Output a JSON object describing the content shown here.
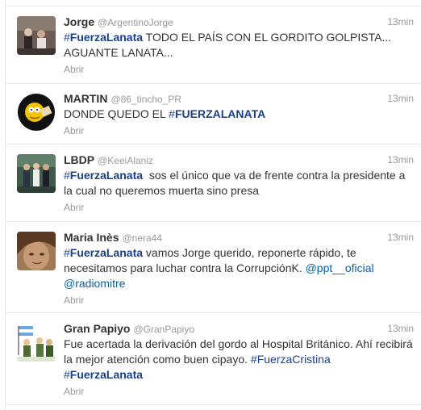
{
  "tweets": [
    {
      "name": "Jorge",
      "handle": "@ArgentinoJorge",
      "time": "13min",
      "text": {
        "hashtag_hash": "#",
        "hashtag_word": "FuerzaLanata",
        "body": " TODO EL PAÍS CON EL GORDITO GOLPISTA... AGUANTE LANATA..."
      },
      "action": "Abrir",
      "avatar_icon": "group-photo-avatar"
    },
    {
      "name": "MARTIN",
      "handle": "@86_tincho_PR",
      "time": "13min",
      "text": {
        "body": "DONDE QUEDO EL ",
        "hashtag_hash": "#",
        "hashtag_word": "FUERZALANATA"
      },
      "action": "Abrir",
      "avatar_icon": "cartoon-character-avatar"
    },
    {
      "name": "LBDP",
      "handle": "@KeeiAlaniz",
      "time": "13min",
      "text": {
        "hashtag_hash": "#",
        "hashtag_word": "FuerzaLanata",
        "body": "  sos el único que va de frente contra la presidente a la cual no queremos muerta sino presa"
      },
      "action": "Abrir",
      "avatar_icon": "friends-photo-avatar"
    },
    {
      "name": "Maria Inès",
      "handle": "@nera44",
      "time": "13min",
      "text": {
        "hashtag_hash": "#",
        "hashtag_word": "FuerzaLanata",
        "body": " vamos Jorge querido, reponerte rápido, te necesitamos para luchar contra la CorrupciónK. ",
        "mention_1": "@ppt__oficial",
        "mention_2": "@radiomitre"
      },
      "action": "Abrir",
      "avatar_icon": "portrait-photo-avatar"
    },
    {
      "name": "Gran Papiyo",
      "handle": "@GranPapiyo",
      "time": "13min",
      "text": {
        "body": "Fue acertada la derivación del gordo al Hospital Británico. Ahí recibirá la mejor atención como buen cipayo. ",
        "hashtag2_hash": "#",
        "hashtag2_word": "FuerzaCristina",
        "hashtag_hash": "#",
        "hashtag_word": "FuerzaLanata"
      },
      "action": "Abrir",
      "avatar_icon": "cartoon-soldiers-flag-avatar"
    }
  ],
  "colors": {
    "hashtag": "#1a3f8c",
    "link": "#0a5fa8",
    "meta_gray": "#999999",
    "text": "#333333",
    "divider": "#e8e8e8"
  }
}
